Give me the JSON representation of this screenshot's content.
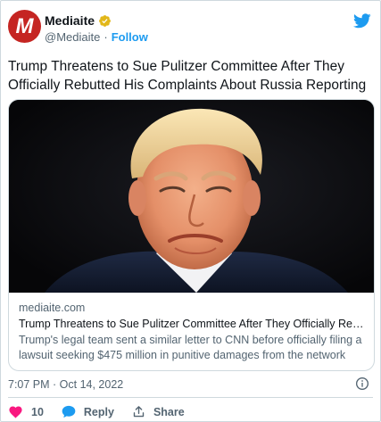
{
  "account": {
    "display_name": "Mediaite",
    "handle": "@Mediaite",
    "separator": "·",
    "follow_label": "Follow",
    "avatar_letter": "M"
  },
  "tweet": {
    "text": "Trump Threatens to Sue Pulitzer Committee After They Officially Rebutted His Complaints About Russia Reporting"
  },
  "link_card": {
    "domain": "mediaite.com",
    "title": "Trump Threatens to Sue Pulitzer Committee After They Officially Rebutte...",
    "description": "Trump's legal team sent a similar letter to CNN before officially filing a lawsuit seeking $475 million in punitive damages from the network"
  },
  "meta": {
    "timestamp": "7:07 PM · Oct 14, 2022"
  },
  "actions": {
    "like_count": "10",
    "reply_label": "Reply",
    "share_label": "Share"
  },
  "colors": {
    "brand_blue": "#1d9bf0",
    "like_pink": "#f91880",
    "avatar_red": "#c52522",
    "verified_gold": "#e2b719"
  },
  "icons": [
    "verified-badge-icon",
    "twitter-bird-icon",
    "info-icon",
    "heart-icon",
    "reply-bubble-icon",
    "share-icon"
  ]
}
